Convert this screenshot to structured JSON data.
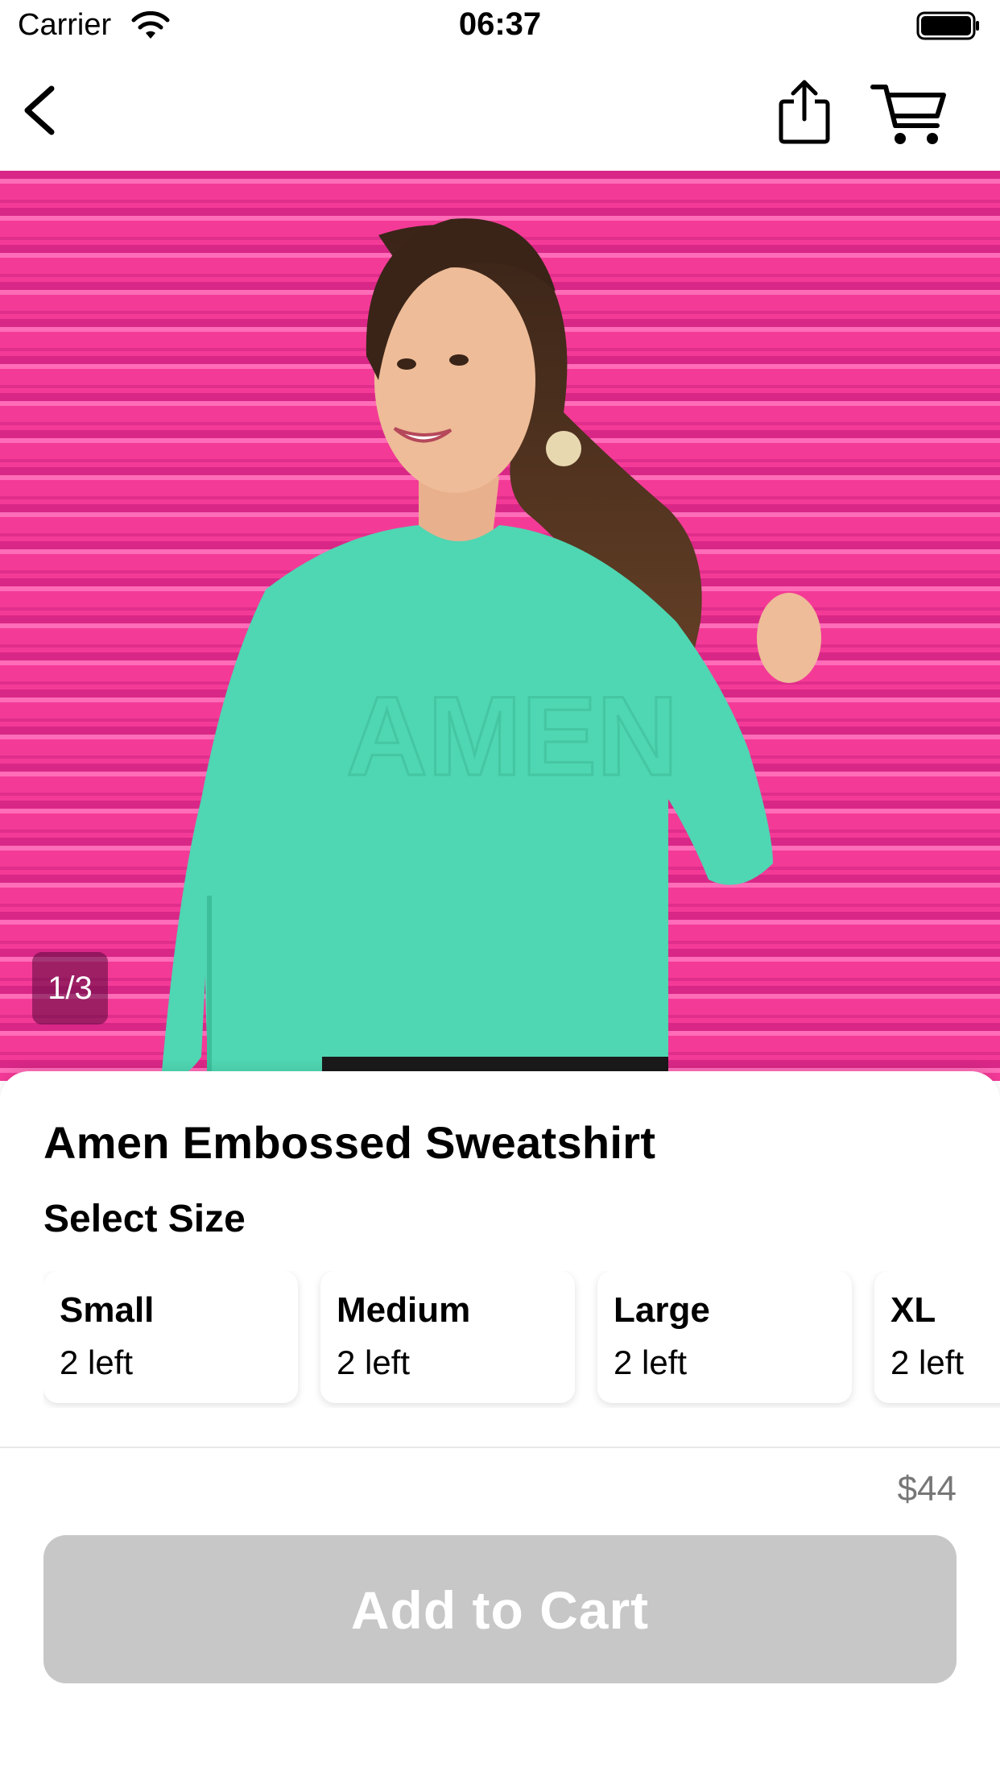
{
  "status_bar": {
    "carrier": "Carrier",
    "time": "06:37"
  },
  "nav": {
    "back_icon": "chevron-left-icon",
    "share_icon": "share-icon",
    "cart_icon": "cart-icon"
  },
  "gallery": {
    "counter": "1/3",
    "background_color": "#f0358f",
    "sweater_color": "#4fd6b2"
  },
  "product": {
    "title": "Amen Embossed Sweatshirt",
    "select_size_label": "Select Size",
    "sizes": [
      {
        "name": "Small",
        "stock": "2 left"
      },
      {
        "name": "Medium",
        "stock": "2 left"
      },
      {
        "name": "Large",
        "stock": "2 left"
      },
      {
        "name": "XL",
        "stock": "2 left"
      }
    ]
  },
  "footer": {
    "price": "$44",
    "add_to_cart": "Add to Cart",
    "button_color": "#c7c7c7"
  }
}
